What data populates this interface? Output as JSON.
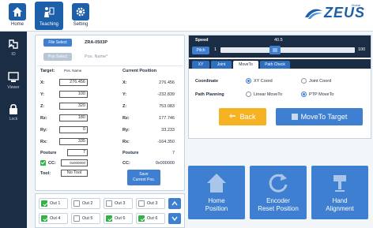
{
  "topbar": {
    "home_label": "Home",
    "teaching_label": "Teaching",
    "setting_label": "Setting",
    "brand_global": "Global",
    "brand_name": "ZEUS"
  },
  "rail": {
    "io_label": "IO",
    "viewer_label": "Viewer",
    "lock_label": "Lock"
  },
  "file": {
    "file_select_label": "File Select",
    "file_name": "ZRA-0503P",
    "pos_select_label": "Pos Select",
    "pos_name": "Pos. Name*"
  },
  "target": {
    "title": "Target:",
    "pos_name_label": "Pos. Name",
    "rows": [
      {
        "label": "X:",
        "value": "276.456"
      },
      {
        "label": "Y:",
        "value": "100"
      },
      {
        "label": "Z:",
        "value": "320"
      },
      {
        "label": "Rz:",
        "value": "180"
      },
      {
        "label": "Ry:",
        "value": "0"
      },
      {
        "label": "Rx:",
        "value": "335"
      }
    ],
    "posture_label": "Posture",
    "posture_value": "7",
    "cc_label": "CC:",
    "cc_value": "0x000000",
    "tool_label": "Tool:",
    "tool_value": "No Tool"
  },
  "current": {
    "title": "Current Position",
    "rows": [
      {
        "label": "X:",
        "value": "276.456"
      },
      {
        "label": "Y:",
        "value": "-232.839"
      },
      {
        "label": "Z:",
        "value": "753.083"
      },
      {
        "label": "Rz:",
        "value": "177.746"
      },
      {
        "label": "Ry:",
        "value": "33.233"
      },
      {
        "label": "Rx:",
        "value": "-164.350"
      }
    ],
    "posture_label": "Posture",
    "posture_value": "7",
    "cc_label": "CC:",
    "cc_value": "0x000000",
    "save_label_1": "Save",
    "save_label_2": "Current Pos."
  },
  "outputs": [
    {
      "label": "Out 1",
      "on": true
    },
    {
      "label": "Out 2",
      "on": false
    },
    {
      "label": "Out 3",
      "on": false
    },
    {
      "label": "Out 3",
      "on": false
    },
    {
      "label": "Out 4",
      "on": true
    },
    {
      "label": "Out 5",
      "on": false
    },
    {
      "label": "Out 6",
      "on": true
    },
    {
      "label": "Out 6",
      "on": true
    }
  ],
  "speed": {
    "label": "Speed",
    "value": "40.5",
    "min": "1",
    "max": "100",
    "fraction": 0.4,
    "pitch_label": "Pitch"
  },
  "tabs": [
    "XY",
    "Joint",
    "MoveTo",
    "Path Check"
  ],
  "active_tab": "MoveTo",
  "moveto": {
    "coordinate_label": "Coordinate",
    "coord_opt1": "XY Coord",
    "coord_opt2": "Joint Coord",
    "path_label": "Path Planning",
    "path_opt1": "Linear MoveTo",
    "path_opt2": "PTP MoveTo",
    "back_label": "Back",
    "moveto_target_label": "MoveTo Target"
  },
  "tiles": {
    "home_position": [
      "Home",
      "Position"
    ],
    "encoder_reset": [
      "Encoder",
      "Reset Position"
    ],
    "hand_alignment": [
      "Hand",
      "Alignment"
    ]
  },
  "colors": {
    "accent": "#3f7fd1",
    "dark": "#1b2d44",
    "back_button": "#f5b324",
    "check_green": "#34b24a"
  }
}
